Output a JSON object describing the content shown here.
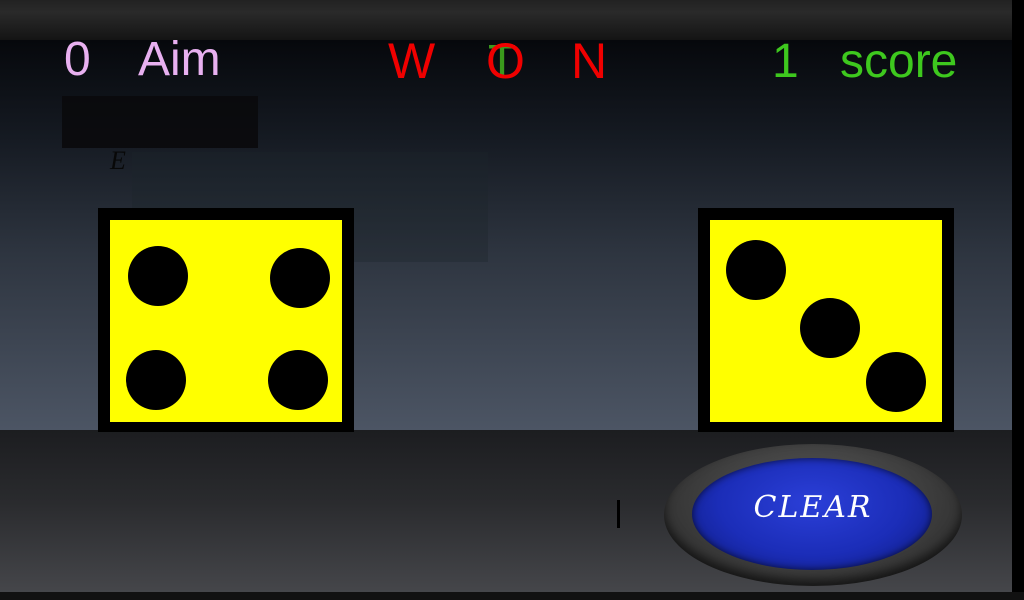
{
  "hud": {
    "aim_value": "0",
    "aim_label": "Aim",
    "score_value": "1",
    "score_label": "score",
    "status_letters": [
      "W",
      "O",
      "N"
    ],
    "status_overlay_letter": "T",
    "faint_glyph": "E"
  },
  "dice": {
    "left_value": 4,
    "right_value": 3,
    "face_color": "#ffff00",
    "pip_color": "#000000"
  },
  "controls": {
    "clear_label": "CLEAR",
    "clear_color": "#1b2db8"
  },
  "colors": {
    "aim": "#e8b0f0",
    "status": "#f00000",
    "score": "#3ec81e"
  }
}
